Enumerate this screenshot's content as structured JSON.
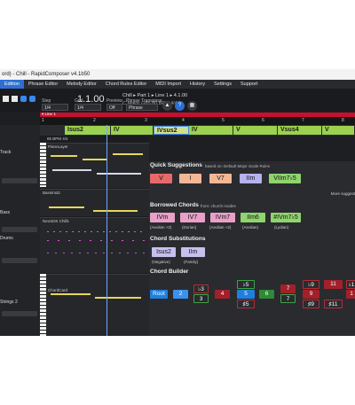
{
  "window": {
    "title": "ord) - Chill - RapidComposer v4.1b50"
  },
  "tabs": [
    "Edition",
    "Phrase Editor",
    "Melody Editor",
    "Chord Rules Editor",
    "MIDI Import",
    "History",
    "Settings",
    "Support"
  ],
  "toolbar": {
    "position": "1.1.00",
    "song_info": "Chill ▸ Part 1 ▸ Line 1 ▸ 4.1.00",
    "key_info": "C Major   ⊙85.00 BPM   4/4",
    "step_label": "Step",
    "step_value": "1/4",
    "grid_label": "Grid",
    "grid_value": "1/4",
    "preview_label": "Preview",
    "preview_value": "Off",
    "phrase_transpose_label": "Phrase Transpose",
    "phrase_transpose_value": "Phrase"
  },
  "song_line": "▾ Line 1",
  "ruler": [
    "1",
    "2",
    "3",
    "4",
    "5",
    "6",
    "7",
    "8"
  ],
  "chord_lane": [
    {
      "label": "Isus2",
      "color": "#9bd14f"
    },
    {
      "label": "IV",
      "color": "#9bd14f"
    },
    {
      "label": "IVsus2",
      "color": "#cfe08a"
    },
    {
      "label": "IV",
      "color": "#9bd14f"
    },
    {
      "label": "V",
      "color": "#9bd14f"
    },
    {
      "label": "Vsus4",
      "color": "#9bd14f"
    },
    {
      "label": "V",
      "color": "#9bd14f"
    }
  ],
  "tracks": [
    {
      "name": "Track",
      "value": "48"
    },
    {
      "name": "Bass",
      "value": "48"
    },
    {
      "name": "Drums",
      "value": "48"
    },
    {
      "name": "Strings 2",
      "value": "48"
    }
  ],
  "lanes": {
    "tempo": "85 BPM  4/4",
    "piano": "PianoLayer",
    "bass": "BassInst2",
    "drums": "NeoSDK Chill1",
    "strings": "ChordCard"
  },
  "suggestions": {
    "quick_title": "Quick Suggestions",
    "quick_sub": "based on: Default Major Scale Rules",
    "quick": [
      "V",
      "I",
      "V7",
      "IIm",
      "VIIm7♭5"
    ],
    "more": "More suggest",
    "borrowed_title": "Borrowed Chords",
    "borrowed_sub": "from: church modes",
    "borrowed": [
      {
        "label": "IVm",
        "mode": "(Aeolian +2)"
      },
      {
        "label": "IV7",
        "mode": "(Dorian)"
      },
      {
        "label": "IVm7",
        "mode": "(Aeolian +2)"
      },
      {
        "label": "IIm6",
        "mode": "(Aeolian)"
      },
      {
        "label": "#IVm7♭5",
        "mode": "(Lydian)"
      }
    ],
    "subs_title": "Chord Substitutions",
    "subs": [
      {
        "label": "Isus2",
        "note": "(Negative)"
      },
      {
        "label": "IIm",
        "note": "(Family)"
      }
    ],
    "builder_title": "Chord Builder",
    "builder": {
      "root": "Root",
      "two": "2",
      "b3": "♭3",
      "three": "3",
      "four": "4",
      "b5": "♭5",
      "five": "5",
      "sharp5": "♯5",
      "six": "6",
      "b7": "7",
      "seven": "7",
      "b9": "♭9",
      "nine": "9",
      "sharp9": "♯9",
      "eleven": "11",
      "sharp11": "♯11",
      "b13": "♭1",
      "thirteen": "1"
    }
  },
  "colors": {
    "accent": "#2e6fd1",
    "song_line": "#c8102e",
    "chord_green": "#9bd14f"
  }
}
